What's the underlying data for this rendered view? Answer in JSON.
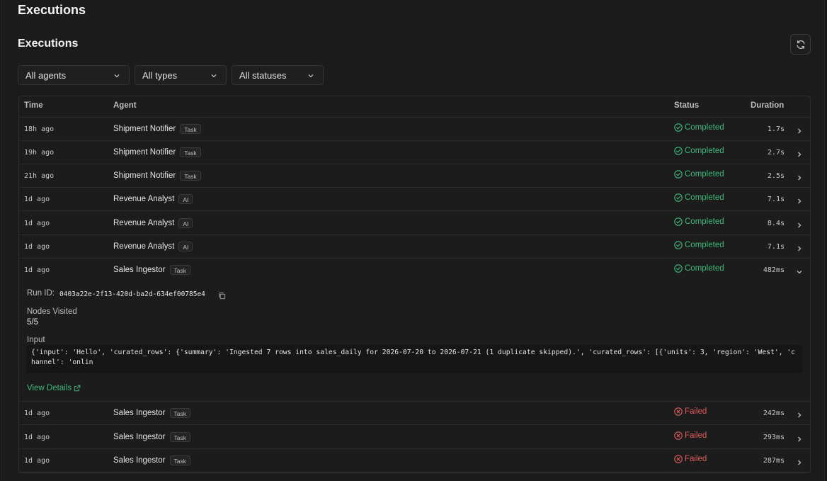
{
  "page": {
    "title": "Executions"
  },
  "section": {
    "title": "Executions",
    "refresh_icon": "refresh-icon"
  },
  "filters": {
    "agents": "All agents",
    "types": "All types",
    "statuses": "All statuses"
  },
  "table": {
    "columns": {
      "time": "Time",
      "agent": "Agent",
      "status": "Status",
      "duration": "Duration"
    },
    "rows": [
      {
        "time": "18h ago",
        "agent": "Shipment Notifier",
        "badge": "Task",
        "status": "Completed",
        "state": "ok",
        "duration": "1.7s"
      },
      {
        "time": "19h ago",
        "agent": "Shipment Notifier",
        "badge": "Task",
        "status": "Completed",
        "state": "ok",
        "duration": "2.7s"
      },
      {
        "time": "21h ago",
        "agent": "Shipment Notifier",
        "badge": "Task",
        "status": "Completed",
        "state": "ok",
        "duration": "2.5s"
      },
      {
        "time": "1d ago",
        "agent": "Revenue Analyst",
        "badge": "AI",
        "status": "Completed",
        "state": "ok",
        "duration": "7.1s"
      },
      {
        "time": "1d ago",
        "agent": "Revenue Analyst",
        "badge": "AI",
        "status": "Completed",
        "state": "ok",
        "duration": "8.4s"
      },
      {
        "time": "1d ago",
        "agent": "Revenue Analyst",
        "badge": "AI",
        "status": "Completed",
        "state": "ok",
        "duration": "7.1s"
      },
      {
        "time": "1d ago",
        "agent": "Sales Ingestor",
        "badge": "Task",
        "status": "Completed",
        "state": "ok",
        "duration": "482ms",
        "expanded": true
      },
      {
        "time": "1d ago",
        "agent": "Sales Ingestor",
        "badge": "Task",
        "status": "Failed",
        "state": "fail",
        "duration": "242ms"
      },
      {
        "time": "1d ago",
        "agent": "Sales Ingestor",
        "badge": "Task",
        "status": "Failed",
        "state": "fail",
        "duration": "293ms"
      },
      {
        "time": "1d ago",
        "agent": "Sales Ingestor",
        "badge": "Task",
        "status": "Failed",
        "state": "fail",
        "duration": "287ms"
      }
    ]
  },
  "detail": {
    "run_id_label": "Run ID:",
    "run_id": "0403a22e-2f13-420d-ba2d-634ef00785e4",
    "nodes_visited_label": "Nodes Visited",
    "nodes_visited": "5/5",
    "input_label": "Input",
    "input_text": "{'input': 'Hello', 'curated_rows': {'summary': 'Ingested 7 rows into sales_daily for 2026-07-20 to 2026-07-21 (1 duplicate skipped).', 'curated_rows': [{'units': 3, 'region': 'West', 'channel': 'onlin",
    "view_details": "View Details"
  },
  "colors": {
    "success": "#3fb97b",
    "failure": "#e05a5a",
    "background": "#1b1b1b"
  }
}
